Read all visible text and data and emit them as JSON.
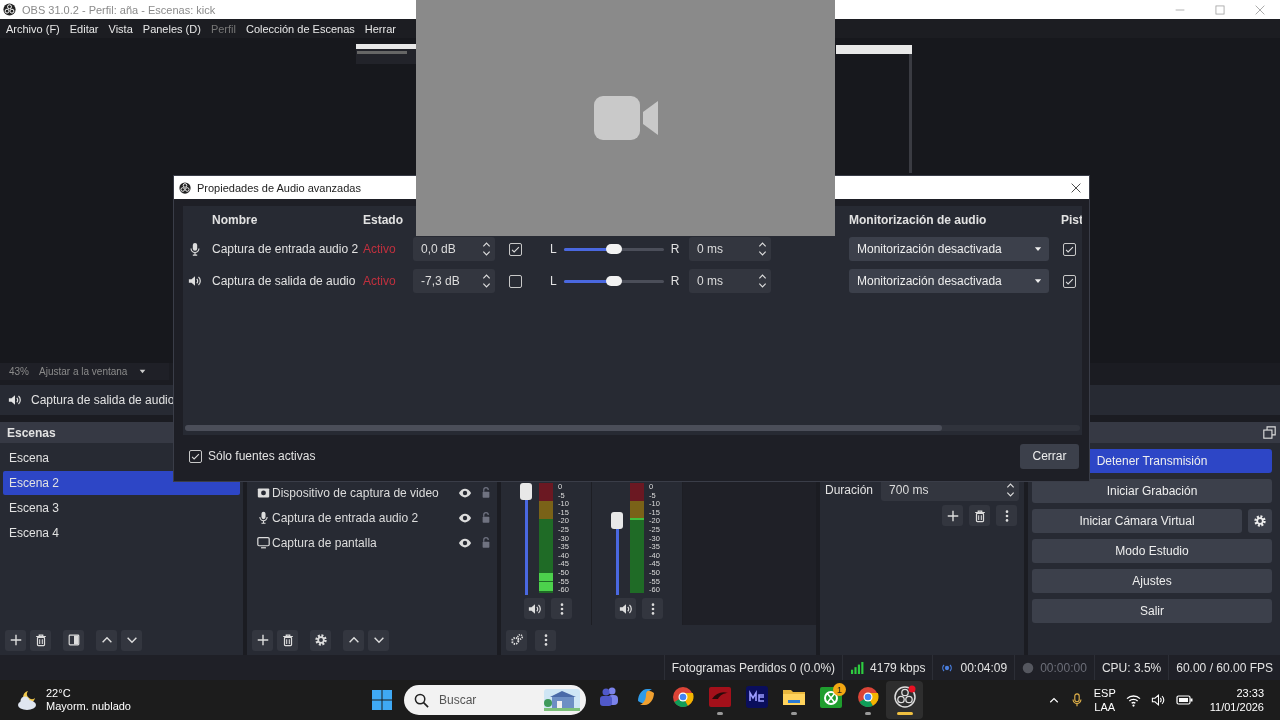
{
  "window": {
    "title": "OBS 31.0.2 - Perfil: aña - Escenas: kick"
  },
  "menu": [
    {
      "label": "Archivo (F)",
      "disabled": false
    },
    {
      "label": "Editar",
      "disabled": false
    },
    {
      "label": "Vista",
      "disabled": false
    },
    {
      "label": "Paneles (D)",
      "disabled": false
    },
    {
      "label": "Perfil",
      "disabled": true
    },
    {
      "label": "Colección de Escenas",
      "disabled": false
    },
    {
      "label": "Herrar",
      "disabled": false
    }
  ],
  "preview": {
    "zoom": "43%",
    "scale_mode": "Ajustar a la ventana"
  },
  "source_toolbar": {
    "kind": "speaker",
    "source": "Captura de salida de audio"
  },
  "scenes": {
    "title": "Escenas",
    "items": [
      {
        "label": "Escena",
        "selected": false
      },
      {
        "label": "Escena 2",
        "selected": true
      },
      {
        "label": "Escena 3",
        "selected": false
      },
      {
        "label": "Escena 4",
        "selected": false
      }
    ]
  },
  "sources": {
    "items": [
      {
        "kind": "camera",
        "name": "Dispositivo de captura de video"
      },
      {
        "kind": "mic",
        "name": "Captura de entrada audio 2"
      },
      {
        "kind": "display",
        "name": "Captura de pantalla"
      }
    ]
  },
  "mixer": {
    "channels": [
      {
        "level": 1.0,
        "scale": [
          "0",
          "-5",
          "-10",
          "-15",
          "-20",
          "-25",
          "-30",
          "-35",
          "-40",
          "-45",
          "-50",
          "-55",
          "-60"
        ]
      },
      {
        "level": 0.7,
        "scale": [
          "0",
          "-5",
          "-10",
          "-15",
          "-20",
          "-25",
          "-30",
          "-35",
          "-40",
          "-45",
          "-50",
          "-55",
          "-60"
        ]
      }
    ]
  },
  "transitions": {
    "duration_label": "Duración",
    "duration": "700 ms"
  },
  "controls": [
    {
      "label": "Detener Transmisión",
      "kind": "plain",
      "active": true
    },
    {
      "label": "Iniciar Grabación",
      "kind": "plain",
      "active": false
    },
    {
      "label": "Iniciar Cámara Virtual",
      "kind": "split",
      "active": false
    },
    {
      "label": "Modo Estudio",
      "kind": "plain",
      "active": false
    },
    {
      "label": "Ajustes",
      "kind": "plain",
      "active": false
    },
    {
      "label": "Salir",
      "kind": "plain",
      "active": false
    }
  ],
  "status_bar": {
    "dropped_frames": "Fotogramas Perdidos 0 (0.0%)",
    "bitrate": "4179 kbps",
    "stream_time": "00:04:09",
    "record_time": "00:00:00",
    "cpu": "CPU: 3.5%",
    "fps": "60.00 / 60.00 FPS"
  },
  "dialog": {
    "title": "Propiedades de Audio avanzadas",
    "columns": [
      "Nombre",
      "Estado",
      "Monitorización de audio",
      "Pist"
    ],
    "rows": [
      {
        "kind": "mic",
        "name": "Captura de entrada audio 2",
        "status": "Activo",
        "volume": "0,0 dB",
        "mono": true,
        "left": "L",
        "level": 0.5,
        "right": "R",
        "offset": "0 ms",
        "monitoring": "Monitorización desactivada",
        "track": true
      },
      {
        "kind": "speaker",
        "name": "Captura de salida de audio",
        "status": "Activo",
        "volume": "-7,3 dB",
        "mono": false,
        "left": "L",
        "level": 0.5,
        "right": "R",
        "offset": "0 ms",
        "monitoring": "Monitorización desactivada",
        "track": true
      }
    ],
    "active_only": {
      "label": "Sólo fuentes activas",
      "checked": true
    },
    "close": "Cerrar"
  },
  "taskbar": {
    "weather": {
      "temperature": "22°C",
      "condition": "Mayorm. nublado"
    },
    "search": {
      "placeholder": "Buscar"
    },
    "apps": [
      {
        "kind": "teams",
        "running": false,
        "selected": false
      },
      {
        "kind": "copilot",
        "running": false,
        "selected": false
      },
      {
        "kind": "chrome",
        "running": false,
        "selected": false
      },
      {
        "kind": "red",
        "running": true,
        "selected": false
      },
      {
        "kind": "me",
        "running": false,
        "selected": false
      },
      {
        "kind": "folder",
        "running": true,
        "selected": false
      },
      {
        "kind": "xbox",
        "running": false,
        "selected": false,
        "badge": "1"
      },
      {
        "kind": "chrome",
        "running": true,
        "selected": false
      },
      {
        "kind": "obs",
        "running": true,
        "selected": true
      }
    ],
    "tray": {
      "language": "ESP",
      "layout": "LAA",
      "time": "23:33",
      "date": "11/01/2026"
    }
  }
}
